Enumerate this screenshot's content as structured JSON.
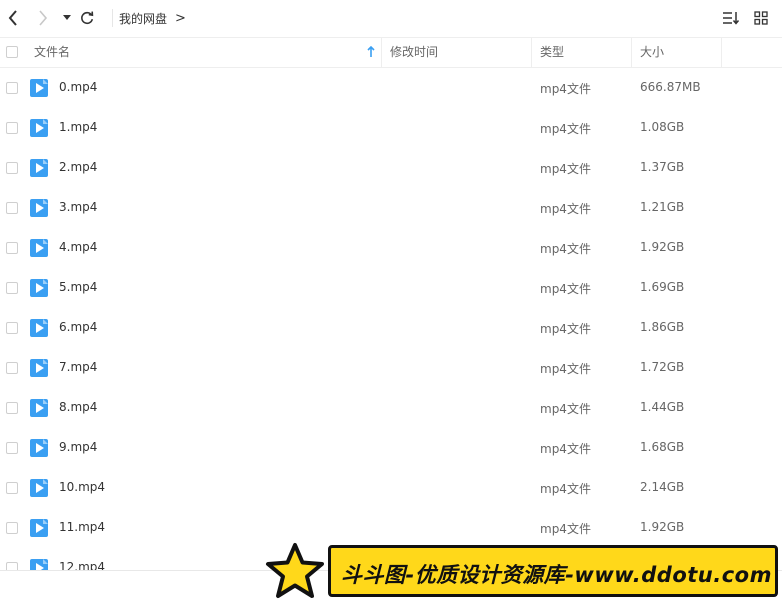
{
  "toolbar": {
    "breadcrumb": "我的网盘",
    "breadcrumb_sep": ">"
  },
  "columns": {
    "name": "文件名",
    "modified": "修改时间",
    "type": "类型",
    "size": "大小"
  },
  "files": [
    {
      "name": "0.mp4",
      "type": "mp4文件",
      "size": "666.87MB"
    },
    {
      "name": "1.mp4",
      "type": "mp4文件",
      "size": "1.08GB"
    },
    {
      "name": "2.mp4",
      "type": "mp4文件",
      "size": "1.37GB"
    },
    {
      "name": "3.mp4",
      "type": "mp4文件",
      "size": "1.21GB"
    },
    {
      "name": "4.mp4",
      "type": "mp4文件",
      "size": "1.92GB"
    },
    {
      "name": "5.mp4",
      "type": "mp4文件",
      "size": "1.69GB"
    },
    {
      "name": "6.mp4",
      "type": "mp4文件",
      "size": "1.86GB"
    },
    {
      "name": "7.mp4",
      "type": "mp4文件",
      "size": "1.72GB"
    },
    {
      "name": "8.mp4",
      "type": "mp4文件",
      "size": "1.44GB"
    },
    {
      "name": "9.mp4",
      "type": "mp4文件",
      "size": "1.68GB"
    },
    {
      "name": "10.mp4",
      "type": "mp4文件",
      "size": "2.14GB"
    },
    {
      "name": "11.mp4",
      "type": "mp4文件",
      "size": "1.92GB"
    },
    {
      "name": "12.mp4",
      "type": "",
      "size": ""
    }
  ],
  "watermark": {
    "text": "斗斗图-优质设计资源库-www.ddotu.com"
  },
  "colors": {
    "accent": "#3a9ff2",
    "banner_bg": "#ffd81a"
  }
}
